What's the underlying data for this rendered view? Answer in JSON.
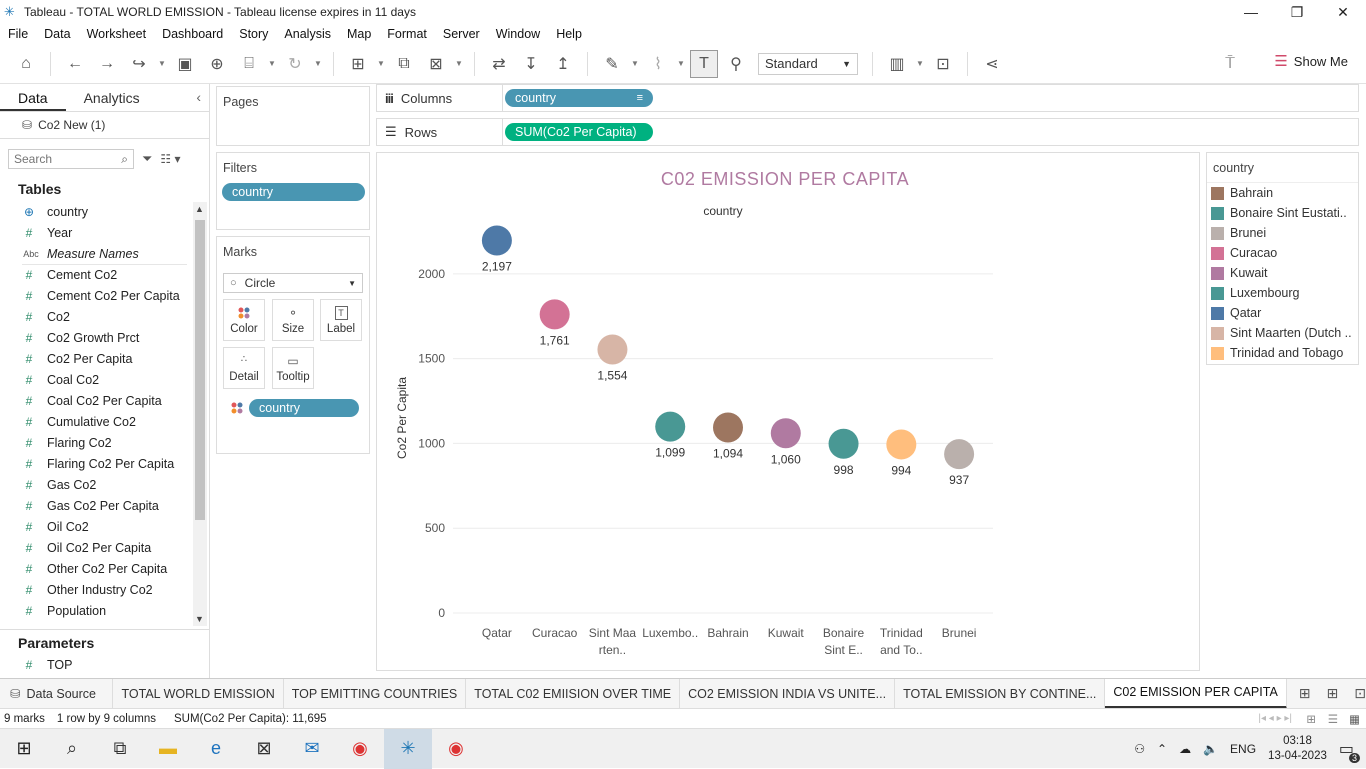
{
  "window": {
    "title": "Tableau - TOTAL WORLD EMISSION - Tableau license expires in 11 days",
    "controls": [
      "—",
      "❐",
      "✕"
    ]
  },
  "menu": [
    "File",
    "Data",
    "Worksheet",
    "Dashboard",
    "Story",
    "Analysis",
    "Map",
    "Format",
    "Server",
    "Window",
    "Help"
  ],
  "toolbar": {
    "fit_select": "Standard",
    "show_me": "Show Me"
  },
  "left_pane": {
    "tabs": [
      "Data",
      "Analytics"
    ],
    "datasource": "Co2 New (1)",
    "search_placeholder": "Search",
    "tables_heading": "Tables",
    "fields": [
      {
        "icon": "globe-icon",
        "name": "country"
      },
      {
        "icon": "hash-icon",
        "name": "Year"
      },
      {
        "icon": "abc-icon",
        "name": "Measure Names"
      },
      {
        "icon": "hash-icon",
        "name": "Cement Co2"
      },
      {
        "icon": "hash-icon",
        "name": "Cement Co2 Per Capita"
      },
      {
        "icon": "hash-icon",
        "name": "Co2"
      },
      {
        "icon": "hash-icon",
        "name": "Co2 Growth Prct"
      },
      {
        "icon": "hash-icon",
        "name": "Co2 Per Capita"
      },
      {
        "icon": "hash-icon",
        "name": "Coal Co2"
      },
      {
        "icon": "hash-icon",
        "name": "Coal Co2 Per Capita"
      },
      {
        "icon": "hash-icon",
        "name": "Cumulative Co2"
      },
      {
        "icon": "hash-icon",
        "name": "Flaring Co2"
      },
      {
        "icon": "hash-icon",
        "name": "Flaring Co2 Per Capita"
      },
      {
        "icon": "hash-icon",
        "name": "Gas Co2"
      },
      {
        "icon": "hash-icon",
        "name": "Gas Co2 Per Capita"
      },
      {
        "icon": "hash-icon",
        "name": "Oil Co2"
      },
      {
        "icon": "hash-icon",
        "name": "Oil Co2 Per Capita"
      },
      {
        "icon": "hash-icon",
        "name": "Other Co2 Per Capita"
      },
      {
        "icon": "hash-icon",
        "name": "Other Industry Co2"
      },
      {
        "icon": "hash-icon",
        "name": "Population"
      }
    ],
    "parameters_heading": "Parameters",
    "parameters": [
      {
        "icon": "hash-icon",
        "name": "TOP"
      }
    ]
  },
  "cards": {
    "pages": "Pages",
    "filters": "Filters",
    "filter_pill": "country",
    "marks": "Marks",
    "mark_type": "Circle",
    "mark_buttons": [
      {
        "icon": "color-dots-icon",
        "label": "Color"
      },
      {
        "icon": "size-icon",
        "label": "Size"
      },
      {
        "icon": "label-icon",
        "label": "Label"
      },
      {
        "icon": "detail-icon",
        "label": "Detail"
      },
      {
        "icon": "tooltip-icon",
        "label": "Tooltip"
      }
    ],
    "marks_pill": "country"
  },
  "shelves": {
    "columns_label": "Columns",
    "columns_pill": "country",
    "rows_label": "Rows",
    "rows_pill": "SUM(Co2 Per Capita)"
  },
  "chart_data": {
    "type": "scatter",
    "title": "C02 EMISSION PER CAPITA",
    "xlabel": "country",
    "ylabel": "Co2 Per Capita",
    "ylim": [
      0,
      2300
    ],
    "yticks": [
      0,
      500,
      1000,
      1500,
      2000
    ],
    "categories": [
      "Qatar",
      "Curacao",
      "Sint Maarten..",
      "Luxembo..",
      "Bahrain",
      "Kuwait",
      "Bonaire Sint E..",
      "Trinidad and To..",
      "Brunei"
    ],
    "category_lines": [
      [
        "Qatar"
      ],
      [
        "Curacao"
      ],
      [
        "Sint Maa",
        "rten.."
      ],
      [
        "Luxembo.."
      ],
      [
        "Bahrain"
      ],
      [
        "Kuwait"
      ],
      [
        "Bonaire",
        "Sint E.."
      ],
      [
        "Trinidad",
        "and To.."
      ],
      [
        "Brunei"
      ]
    ],
    "values": [
      2197,
      1761,
      1554,
      1099,
      1094,
      1060,
      998,
      994,
      937
    ],
    "value_labels": [
      "2,197",
      "1,761",
      "1,554",
      "1,099",
      "1,094",
      "1,060",
      "998",
      "994",
      "937"
    ],
    "colors": [
      "#4e79a7",
      "#d37295",
      "#d7b5a6",
      "#499894",
      "#9d7660",
      "#b07aa1",
      "#499894",
      "#ffbe7d",
      "#bab0ac"
    ],
    "grid": true,
    "legend": "right"
  },
  "legend": {
    "title": "country",
    "items": [
      {
        "label": "Bahrain",
        "color": "#9d7660"
      },
      {
        "label": "Bonaire Sint Eustati..",
        "color": "#499894"
      },
      {
        "label": "Brunei",
        "color": "#bab0ac"
      },
      {
        "label": "Curacao",
        "color": "#d37295"
      },
      {
        "label": "Kuwait",
        "color": "#b07aa1"
      },
      {
        "label": "Luxembourg",
        "color": "#499894"
      },
      {
        "label": "Qatar",
        "color": "#4e79a7"
      },
      {
        "label": "Sint Maarten (Dutch ..",
        "color": "#d7b5a6"
      },
      {
        "label": "Trinidad and Tobago",
        "color": "#ffbe7d"
      }
    ]
  },
  "sheet_tabs": {
    "datasource": "Data Source",
    "tabs": [
      "TOTAL WORLD EMISSION",
      "TOP EMITTING COUNTRIES",
      "TOTAL C02 EMIISION OVER TIME",
      "CO2 EMISSION INDIA VS UNITE...",
      "TOTAL EMISSION BY CONTINE...",
      "C02 EMISSION PER CAPITA"
    ],
    "active": 5
  },
  "status": {
    "marks": "9 marks",
    "dims": "1 row by 9 columns",
    "sum": "SUM(Co2 Per Capita): 11,695"
  },
  "taskbar": {
    "lang": "ENG",
    "time": "03:18",
    "date": "13-04-2023",
    "notifications": "3"
  }
}
